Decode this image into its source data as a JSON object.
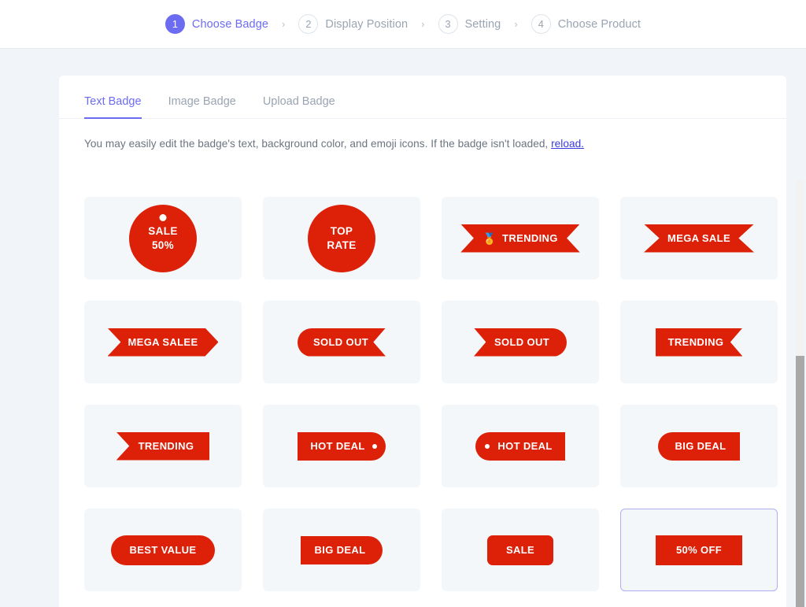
{
  "colors": {
    "accent": "#6c6cf2",
    "badge_red": "#dc2108",
    "page_bg": "#f1f5f9",
    "card_bg": "#f3f7f9",
    "selected_border": "#b0aef2"
  },
  "stepper": {
    "separator": "›",
    "steps": [
      {
        "num": "1",
        "label": "Choose Badge",
        "active": true
      },
      {
        "num": "2",
        "label": "Display Position",
        "active": false
      },
      {
        "num": "3",
        "label": "Setting",
        "active": false
      },
      {
        "num": "4",
        "label": "Choose Product",
        "active": false
      }
    ]
  },
  "tabs": [
    {
      "label": "Text Badge",
      "active": true
    },
    {
      "label": "Image Badge",
      "active": false
    },
    {
      "label": "Upload Badge",
      "active": false
    }
  ],
  "description": {
    "text": "You may easily edit the badge's text, background color, and emoji icons. If the badge isn't loaded, ",
    "link": "reload."
  },
  "badges": [
    {
      "id": 1,
      "text": "SALE\n50%",
      "line1": "SALE",
      "line2": "50%",
      "shape": "circle-tag",
      "emoji": "",
      "hole": "top",
      "selected": false
    },
    {
      "id": 2,
      "text": "TOP\nRATE",
      "line1": "TOP",
      "line2": "RATE",
      "shape": "circle",
      "emoji": "",
      "hole": "none",
      "selected": false
    },
    {
      "id": 3,
      "text": "TRENDING",
      "shape": "ribbon-both-notched",
      "emoji": "🏅",
      "hole": "none",
      "selected": false
    },
    {
      "id": 4,
      "text": "MEGA SALE",
      "shape": "ribbon-both-notched-wide",
      "emoji": "",
      "hole": "none",
      "selected": false
    },
    {
      "id": 5,
      "text": "MEGA SALEE",
      "shape": "left-notch-right-point",
      "emoji": "",
      "hole": "none",
      "selected": false
    },
    {
      "id": 6,
      "text": "SOLD OUT",
      "shape": "round-left-notch-right",
      "emoji": "",
      "hole": "none",
      "selected": false
    },
    {
      "id": 7,
      "text": "SOLD OUT",
      "shape": "notch-left-round-right",
      "emoji": "",
      "hole": "none",
      "selected": false
    },
    {
      "id": 8,
      "text": "TRENDING",
      "shape": "flat-left-notch-right",
      "emoji": "",
      "hole": "none",
      "selected": false
    },
    {
      "id": 9,
      "text": "TRENDING",
      "shape": "notch-left-flat-right",
      "emoji": "",
      "hole": "none",
      "selected": false
    },
    {
      "id": 10,
      "text": "HOT DEAL",
      "shape": "flat-left-round-right",
      "emoji": "",
      "hole": "right",
      "selected": false
    },
    {
      "id": 11,
      "text": "HOT DEAL",
      "shape": "round-left-flat-right",
      "emoji": "",
      "hole": "left",
      "selected": false
    },
    {
      "id": 12,
      "text": "BIG DEAL",
      "shape": "round-left-flat-right-nohole",
      "emoji": "",
      "hole": "none",
      "selected": false
    },
    {
      "id": 13,
      "text": "BEST VALUE",
      "shape": "pill",
      "emoji": "",
      "hole": "none",
      "selected": false
    },
    {
      "id": 14,
      "text": "BIG DEAL",
      "shape": "flat-left-round-right-plain",
      "emoji": "",
      "hole": "none",
      "selected": false
    },
    {
      "id": 15,
      "text": "SALE",
      "shape": "rounded-rect",
      "emoji": "",
      "hole": "none",
      "selected": false
    },
    {
      "id": 16,
      "text": "50% OFF",
      "shape": "rect",
      "emoji": "",
      "hole": "none",
      "selected": true
    }
  ],
  "scrollbar": {
    "position_percent": 41
  }
}
